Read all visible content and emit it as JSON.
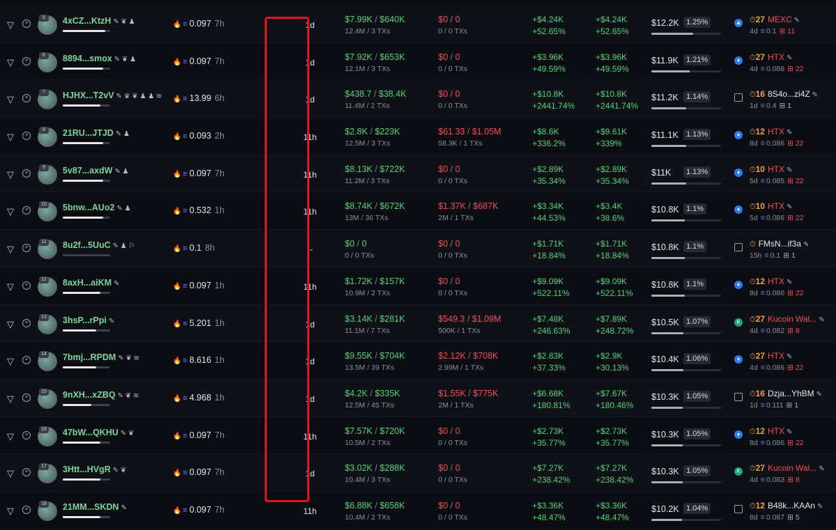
{
  "colors": {
    "positive": "#4ed37a",
    "negative": "#ef4f5b",
    "highlight": "#e5141a",
    "background": "#0b0c10"
  },
  "icons": {
    "filter": "filter-icon",
    "menu": "menu-icon",
    "edit": "edit-icon",
    "sol": "sol-icon",
    "clock": "clock-icon",
    "swap": "swap-icon"
  },
  "rows": [
    {
      "rank": "5",
      "wallet": "4xCZ...KtzH",
      "badges": "✎ ❦ ♟",
      "bal": "0.097",
      "age": "7h",
      "hold": "1d",
      "bought": "$7.99K",
      "bought_total": "$640K",
      "bought_sub": "12.4M / 3 TXs",
      "sold": "$0",
      "sold_total": "0",
      "sold_sub": "0 / 0 TXs",
      "pnl_u": "+$4.24K",
      "pnl_u_pct": "+52.65%",
      "pnl_r": "+$4.24K",
      "pnl_r_pct": "+52.65%",
      "rem": "$12.2K",
      "rem_pct": "1.25%",
      "f_cnt": "27",
      "f_ex": "MEXC",
      "f_age": "4d",
      "f_sol": "0.1",
      "f_tx": "11",
      "f_icon": "mexc",
      "bar": 0.9,
      "rem_fill": 0.6
    },
    {
      "rank": "6",
      "wallet": "8894...smox",
      "badges": "✎ ❦ ♟",
      "bal": "0.097",
      "age": "7h",
      "hold": "1d",
      "bought": "$7.92K",
      "bought_total": "$653K",
      "bought_sub": "12.1M / 3 TXs",
      "sold": "$0",
      "sold_total": "0",
      "sold_sub": "0 / 0 TXs",
      "pnl_u": "+$3.96K",
      "pnl_u_pct": "+49.59%",
      "pnl_r": "+$3.96K",
      "pnl_r_pct": "+49.59%",
      "rem": "$11.9K",
      "rem_pct": "1.21%",
      "f_cnt": "27",
      "f_ex": "HTX",
      "f_age": "4d",
      "f_sol": "0.086",
      "f_tx": "22",
      "f_icon": "htx",
      "bar": 0.85,
      "rem_fill": 0.55
    },
    {
      "rank": "7",
      "wallet": "HJHX...T2vV",
      "badges": "✎ ♛ ❦ ♟ ♟ ≋",
      "bal": "13.99",
      "age": "6h",
      "hold": "1d",
      "bought": "$438.7",
      "bought_total": "$38.4K",
      "bought_sub": "11.4M / 2 TXs",
      "sold": "$0",
      "sold_total": "0",
      "sold_sub": "0 / 0 TXs",
      "pnl_u": "+$10.8K",
      "pnl_u_pct": "+2441.74%",
      "pnl_r": "+$10.8K",
      "pnl_r_pct": "+2441.74%",
      "rem": "$11.2K",
      "rem_pct": "1.14%",
      "f_cnt": "16",
      "f_ex": "8S4o...zi4Z",
      "f_age": "1d",
      "f_sol": "0.4",
      "f_tx": "1",
      "f_icon": "box",
      "bar": 0.8,
      "rem_fill": 0.5
    },
    {
      "rank": "8",
      "wallet": "21RU...JTJD",
      "badges": "✎ ♟",
      "bal": "0.093",
      "age": "2h",
      "hold": "11h",
      "bought": "$2.8K",
      "bought_total": "$223K",
      "bought_sub": "12.5M / 3 TXs",
      "sold": "$61.33",
      "sold_total": "$1.05M",
      "sold_sub": "58.3K / 1 TXs",
      "pnl_u": "+$8.6K",
      "pnl_u_pct": "+336.2%",
      "pnl_r": "+$9.61K",
      "pnl_r_pct": "+339%",
      "rem": "$11.1K",
      "rem_pct": "1.13%",
      "f_cnt": "12",
      "f_ex": "HTX",
      "f_age": "8d",
      "f_sol": "0.086",
      "f_tx": "22",
      "f_icon": "htx",
      "bar": 0.85,
      "rem_fill": 0.5
    },
    {
      "rank": "9",
      "wallet": "5v87...axdW",
      "badges": "✎ ♟",
      "bal": "0.097",
      "age": "7h",
      "hold": "11h",
      "bought": "$8.13K",
      "bought_total": "$722K",
      "bought_sub": "11.2M / 3 TXs",
      "sold": "$0",
      "sold_total": "0",
      "sold_sub": "0 / 0 TXs",
      "pnl_u": "+$2.89K",
      "pnl_u_pct": "+35.34%",
      "pnl_r": "+$2.89K",
      "pnl_r_pct": "+35.34%",
      "rem": "$11K",
      "rem_pct": "1.13%",
      "f_cnt": "10",
      "f_ex": "HTX",
      "f_age": "5d",
      "f_sol": "0.085",
      "f_tx": "22",
      "f_icon": "htx",
      "bar": 0.85,
      "rem_fill": 0.5
    },
    {
      "rank": "10",
      "wallet": "5bnw...AUo2",
      "badges": "✎ ♟",
      "bal": "0.532",
      "age": "1h",
      "hold": "11h",
      "bought": "$8.74K",
      "bought_total": "$672K",
      "bought_sub": "13M / 36 TXs",
      "sold": "$1.37K",
      "sold_total": "$687K",
      "sold_sub": "2M / 1 TXs",
      "pnl_u": "+$3.34K",
      "pnl_u_pct": "+44.53%",
      "pnl_r": "+$3.4K",
      "pnl_r_pct": "+38.6%",
      "rem": "$10.8K",
      "rem_pct": "1.1%",
      "f_cnt": "10",
      "f_ex": "HTX",
      "f_age": "5d",
      "f_sol": "0.086",
      "f_tx": "22",
      "f_icon": "htx",
      "bar": 0.85,
      "rem_fill": 0.48
    },
    {
      "rank": "11",
      "wallet": "8u2f...5UuC",
      "badges": "✎ ♟ ⚐",
      "bal": "0.1",
      "age": "8h",
      "hold": "--",
      "bought": "$0",
      "bought_total": "0",
      "bought_sub": "0 / 0 TXs",
      "sold": "$0",
      "sold_total": "0",
      "sold_sub": "0 / 0 TXs",
      "pnl_u": "+$1.71K",
      "pnl_u_pct": "+18.84%",
      "pnl_r": "+$1.71K",
      "pnl_r_pct": "+18.84%",
      "rem": "$10.8K",
      "rem_pct": "1.1%",
      "f_cnt": "",
      "f_ex": "FMsN...if3a",
      "f_age": "15h",
      "f_sol": "0.1",
      "f_tx": "1",
      "f_icon": "box",
      "bar": 0.0,
      "rem_fill": 0.48
    },
    {
      "rank": "12",
      "wallet": "8axH...aiKM",
      "badges": "✎",
      "bal": "0.097",
      "age": "1h",
      "hold": "11h",
      "bought": "$1.72K",
      "bought_total": "$157K",
      "bought_sub": "10.9M / 2 TXs",
      "sold": "$0",
      "sold_total": "0",
      "sold_sub": "0 / 0 TXs",
      "pnl_u": "+$9.09K",
      "pnl_u_pct": "+522.11%",
      "pnl_r": "+$9.09K",
      "pnl_r_pct": "+522.11%",
      "rem": "$10.8K",
      "rem_pct": "1.1%",
      "f_cnt": "12",
      "f_ex": "HTX",
      "f_age": "8d",
      "f_sol": "0.086",
      "f_tx": "22",
      "f_icon": "htx",
      "bar": 0.8,
      "rem_fill": 0.48
    },
    {
      "rank": "13",
      "wallet": "3hsP...rPpi",
      "badges": "✎",
      "bal": "5.201",
      "age": "1h",
      "hold": "1d",
      "bought": "$3.14K",
      "bought_total": "$281K",
      "bought_sub": "11.1M / 7 TXs",
      "sold": "$549.3",
      "sold_total": "$1.09M",
      "sold_sub": "500K / 1 TXs",
      "pnl_u": "+$7.48K",
      "pnl_u_pct": "+246.63%",
      "pnl_r": "+$7.89K",
      "pnl_r_pct": "+248.72%",
      "rem": "$10.5K",
      "rem_pct": "1.07%",
      "f_cnt": "27",
      "f_ex": "Kucoin Wal...",
      "f_age": "4d",
      "f_sol": "0.082",
      "f_tx": "8",
      "f_icon": "kucoin",
      "bar": 0.7,
      "rem_fill": 0.46
    },
    {
      "rank": "14",
      "wallet": "7bmj...RPDM",
      "badges": "✎ ❦ ≋",
      "bal": "8.616",
      "age": "1h",
      "hold": "1d",
      "bought": "$9.55K",
      "bought_total": "$704K",
      "bought_sub": "13.5M / 39 TXs",
      "sold": "$2.12K",
      "sold_total": "$708K",
      "sold_sub": "2.99M / 1 TXs",
      "pnl_u": "+$2.83K",
      "pnl_u_pct": "+37.33%",
      "pnl_r": "+$2.9K",
      "pnl_r_pct": "+30.13%",
      "rem": "$10.4K",
      "rem_pct": "1.06%",
      "f_cnt": "27",
      "f_ex": "HTX",
      "f_age": "4d",
      "f_sol": "0.086",
      "f_tx": "22",
      "f_icon": "htx",
      "bar": 0.7,
      "rem_fill": 0.46
    },
    {
      "rank": "15",
      "wallet": "9nXH...xZBQ",
      "badges": "✎ ❦ ≋",
      "bal": "4.968",
      "age": "1h",
      "hold": "1d",
      "bought": "$4.2K",
      "bought_total": "$335K",
      "bought_sub": "12.5M / 45 TXs",
      "sold": "$1.55K",
      "sold_total": "$775K",
      "sold_sub": "2M / 1 TXs",
      "pnl_u": "+$6.68K",
      "pnl_u_pct": "+180.81%",
      "pnl_r": "+$7.67K",
      "pnl_r_pct": "+180.46%",
      "rem": "$10.3K",
      "rem_pct": "1.05%",
      "f_cnt": "16",
      "f_ex": "Dzja...YhBM",
      "f_age": "1d",
      "f_sol": "0.111",
      "f_tx": "1",
      "f_icon": "box",
      "bar": 0.6,
      "rem_fill": 0.45
    },
    {
      "rank": "16",
      "wallet": "47bW...QKHU",
      "badges": "✎ ❦",
      "bal": "0.097",
      "age": "7h",
      "hold": "11h",
      "bought": "$7.57K",
      "bought_total": "$720K",
      "bought_sub": "10.5M / 2 TXs",
      "sold": "$0",
      "sold_total": "0",
      "sold_sub": "0 / 0 TXs",
      "pnl_u": "+$2.73K",
      "pnl_u_pct": "+35.77%",
      "pnl_r": "+$2.73K",
      "pnl_r_pct": "+35.77%",
      "rem": "$10.3K",
      "rem_pct": "1.05%",
      "f_cnt": "12",
      "f_ex": "HTX",
      "f_age": "8d",
      "f_sol": "0.086",
      "f_tx": "22",
      "f_icon": "htx",
      "bar": 0.8,
      "rem_fill": 0.45
    },
    {
      "rank": "17",
      "wallet": "3Htt...HVgR",
      "badges": "✎ ❦",
      "bal": "0.097",
      "age": "7h",
      "hold": "1d",
      "bought": "$3.02K",
      "bought_total": "$288K",
      "bought_sub": "10.4M / 3 TXs",
      "sold": "$0",
      "sold_total": "0",
      "sold_sub": "0 / 0 TXs",
      "pnl_u": "+$7.27K",
      "pnl_u_pct": "+238.42%",
      "pnl_r": "+$7.27K",
      "pnl_r_pct": "+238.42%",
      "rem": "$10.3K",
      "rem_pct": "1.05%",
      "f_cnt": "27",
      "f_ex": "Kucoin Wal...",
      "f_age": "4d",
      "f_sol": "0.083",
      "f_tx": "8",
      "f_icon": "kucoin",
      "bar": 0.8,
      "rem_fill": 0.45
    },
    {
      "rank": "18",
      "wallet": "21MM...SKDN",
      "badges": "✎",
      "bal": "0.097",
      "age": "7h",
      "hold": "11h",
      "bought": "$6.88K",
      "bought_total": "$658K",
      "bought_sub": "10.4M / 2 TXs",
      "sold": "$0",
      "sold_total": "0",
      "sold_sub": "0 / 0 TXs",
      "pnl_u": "+$3.36K",
      "pnl_u_pct": "+48.47%",
      "pnl_r": "+$3.36K",
      "pnl_r_pct": "+48.47%",
      "rem": "$10.2K",
      "rem_pct": "1.04%",
      "f_cnt": "12",
      "f_ex": "B48k...KAAn",
      "f_age": "8d",
      "f_sol": "0.087",
      "f_tx": "5",
      "f_icon": "box",
      "bar": 0.8,
      "rem_fill": 0.44
    }
  ]
}
